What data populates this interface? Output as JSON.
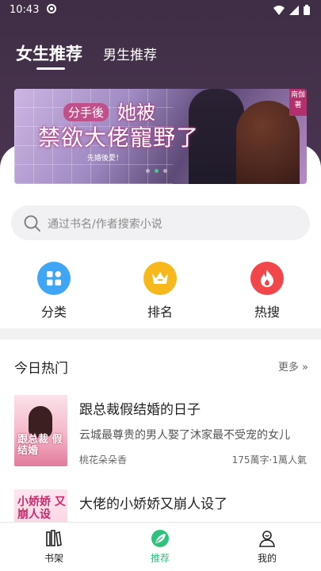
{
  "status_bar": {
    "time": "10:43"
  },
  "tabs": {
    "active": "女生推荐",
    "second": "男生推荐"
  },
  "banner": {
    "title_a": "分手後",
    "title_b": "她被",
    "title_c": "禁欲大佬寵野了",
    "subtitle": "先婚後愛！",
    "tag": "南伽著",
    "page_count": 3,
    "active_index": 1
  },
  "search": {
    "placeholder": "通过书名/作者搜索小说"
  },
  "categories": [
    {
      "label": "分类",
      "icon": "grid-icon",
      "color": "#3ea6f5"
    },
    {
      "label": "排名",
      "icon": "crown-icon",
      "color": "#f6b81b"
    },
    {
      "label": "热搜",
      "icon": "fire-icon",
      "color": "#f2474a"
    }
  ],
  "section": {
    "title": "今日热门",
    "more": "更多 »"
  },
  "books": [
    {
      "title": "跟总裁假结婚的日子",
      "desc": "云城最尊贵的男人娶了沐家最不受宠的女儿",
      "author": "桃花朵朵香",
      "meta": "175萬字·1萬人氣",
      "cover_text": "跟总裁 假结婚"
    },
    {
      "title": "大佬的小娇娇又崩人设了",
      "cover_text": "小娇娇 又崩人设"
    }
  ],
  "bottom_nav": [
    {
      "label": "书架",
      "icon": "bookshelf-icon"
    },
    {
      "label": "推荐",
      "icon": "leaf-icon",
      "active": true
    },
    {
      "label": "我的",
      "icon": "user-icon"
    }
  ],
  "colors": {
    "accent": "#2ec37c",
    "header_bg": "#3f2e45"
  }
}
